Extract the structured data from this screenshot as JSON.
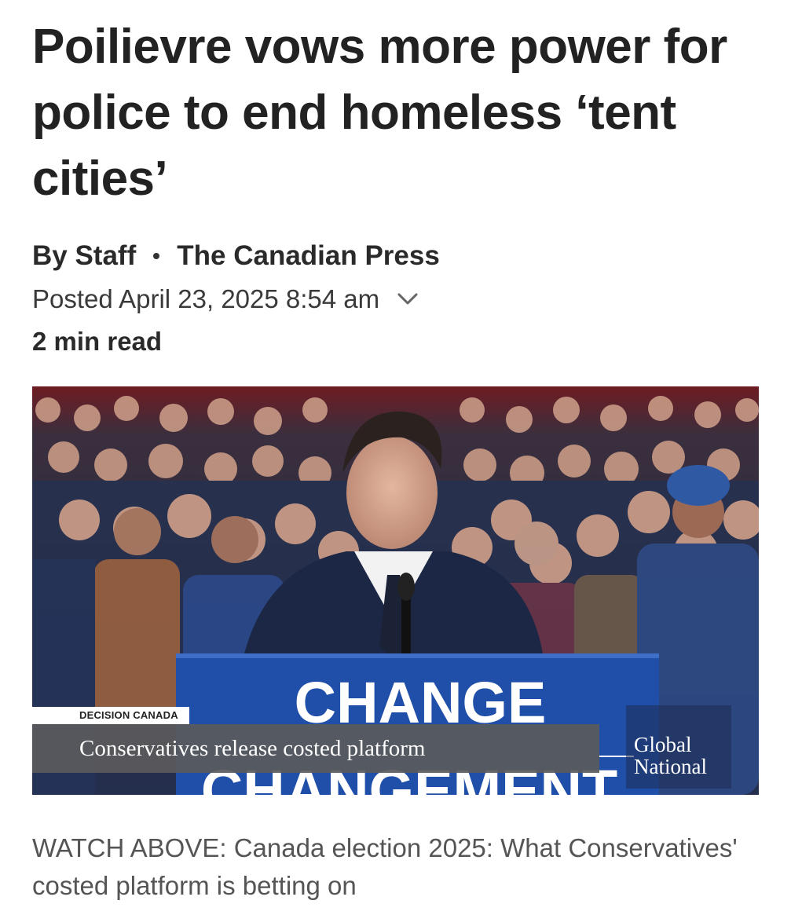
{
  "article": {
    "headline": "Poilievre vows more power for police to end homeless ‘tent cities’",
    "author": "By Staff",
    "outlet": "The Canadian Press",
    "posted": "Posted April 23, 2025 8:54 am",
    "read_time": "2 min read"
  },
  "video": {
    "podium_text": "CHANGE",
    "podium_text_fr": "CHANGEMENT",
    "tag": "DECISION CANADA",
    "title": "Conservatives release costed platform",
    "brand_line1": "Global",
    "brand_line2": "National",
    "colors": {
      "podium": "#1f4fa8",
      "backdrop": "#8b1e24",
      "lower_bar": "#5a5a5c"
    }
  },
  "caption": "WATCH ABOVE: Canada election 2025: What Conservatives' costed platform is betting on",
  "icons": {
    "expand": "chevron-down-icon"
  }
}
